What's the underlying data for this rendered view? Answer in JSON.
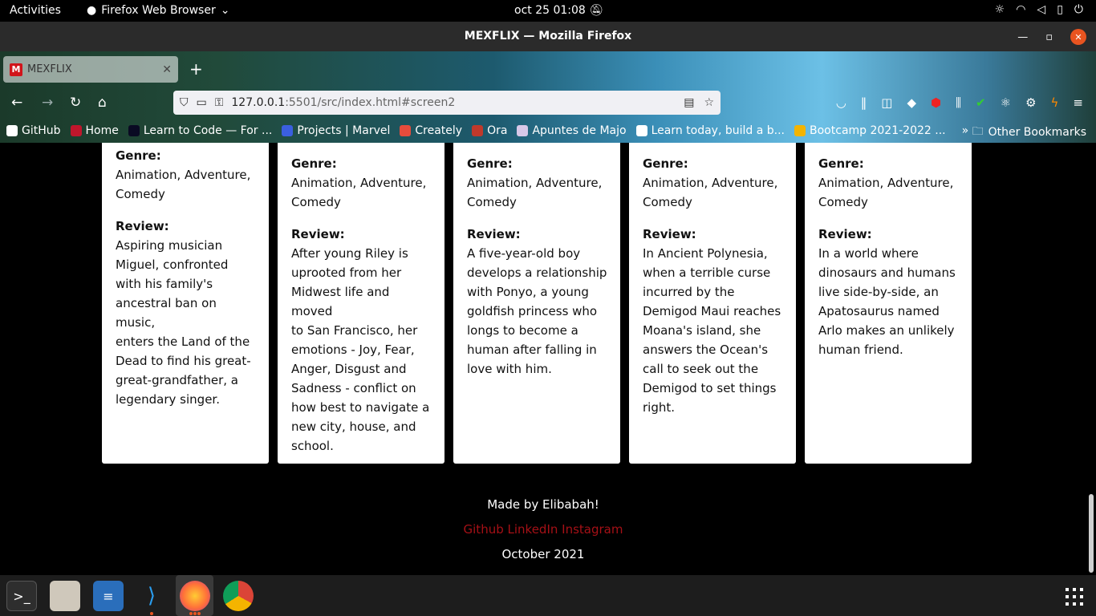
{
  "system": {
    "activities": "Activities",
    "app_name": "Firefox Web Browser",
    "clock": "oct 25  01:08"
  },
  "window": {
    "title": "MEXFLIX — Mozilla Firefox"
  },
  "browser": {
    "tab_title": "MEXFLIX",
    "tab_favicon": "M",
    "url_host": "127.0.0.1",
    "url_rest": ":5501/src/index.html#screen2",
    "bookmarks": [
      {
        "label": "GitHub",
        "color": "#ffffff"
      },
      {
        "label": "Home",
        "color": "#c0162c"
      },
      {
        "label": "Learn to Code — For ...",
        "color": "#0a0a23"
      },
      {
        "label": "Projects | Marvel",
        "color": "#3b5fe0"
      },
      {
        "label": "Creately",
        "color": "#e74c3c"
      },
      {
        "label": "Ora",
        "color": "#c0392b"
      },
      {
        "label": "Apuntes de Majo",
        "color": "#d8c8e8"
      },
      {
        "label": "Learn today, build a b...",
        "color": "#ffffff"
      },
      {
        "label": "Bootcamp 2021-2022 ...",
        "color": "#f4b400"
      }
    ],
    "other_bookmarks": "Other Bookmarks"
  },
  "cards": [
    {
      "genre_label": "Genre:",
      "genre_lines": [
        "Animation, Adventure,",
        "Comedy"
      ],
      "review_label": "Review:",
      "review_lines": [
        "Aspiring musician",
        "Miguel, confronted",
        "with his family's",
        "ancestral ban on music,",
        "enters the Land of the",
        "Dead to find his great-",
        "great-grandfather, a",
        "legendary singer."
      ]
    },
    {
      "genre_label": "Genre:",
      "genre_lines": [
        "Animation, Adventure,",
        "Comedy"
      ],
      "review_label": "Review:",
      "review_lines": [
        "After young Riley is",
        "uprooted from her",
        "Midwest life and moved",
        "to San Francisco, her",
        "emotions - Joy, Fear,",
        "Anger, Disgust and",
        "Sadness - conflict on",
        "how best to navigate a",
        "new city, house, and",
        "school."
      ]
    },
    {
      "genre_label": "Genre:",
      "genre_lines": [
        "Animation, Adventure,",
        "Comedy"
      ],
      "review_label": "Review:",
      "review_lines": [
        "A five-year-old boy",
        "develops a relationship",
        "with Ponyo, a young",
        "goldfish princess who",
        "longs to become a",
        "human after falling in",
        "love with him."
      ]
    },
    {
      "genre_label": "Genre:",
      "genre_lines": [
        "Animation, Adventure,",
        "Comedy"
      ],
      "review_label": "Review:",
      "review_lines": [
        "In Ancient Polynesia,",
        "when a terrible curse",
        "incurred by the",
        "Demigod Maui reaches",
        "Moana's island, she",
        "answers the Ocean's",
        "call to seek out the",
        "Demigod to set things",
        "right."
      ]
    },
    {
      "genre_label": "Genre:",
      "genre_lines": [
        "Animation, Adventure,",
        "Comedy"
      ],
      "review_label": "Review:",
      "review_lines": [
        "In a world where",
        "dinosaurs and humans",
        "live side-by-side, an",
        "Apatosaurus named",
        "Arlo makes an unlikely",
        "human friend."
      ]
    }
  ],
  "footer": {
    "made_by": "Made by Elibabah!",
    "links": [
      "Github",
      "LinkedIn",
      "Instagram"
    ],
    "date": "October 2021",
    "link_color": "#a51016"
  }
}
